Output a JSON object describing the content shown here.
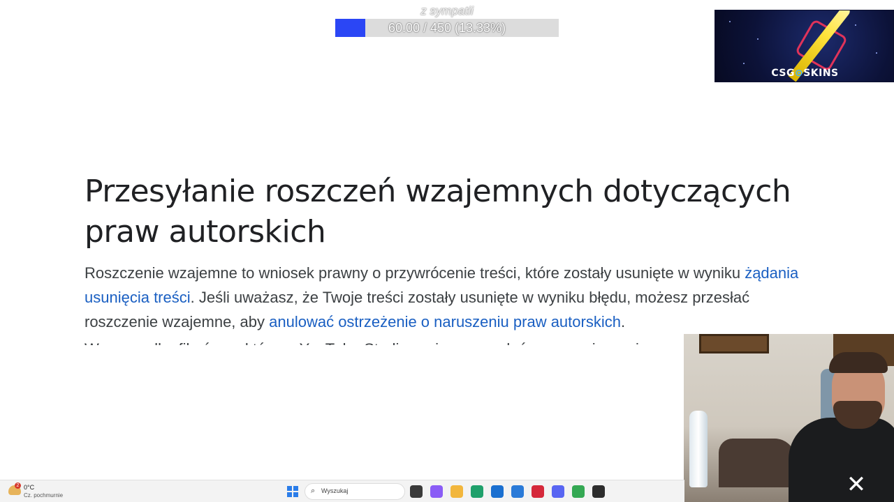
{
  "donation": {
    "label": "z sympatii",
    "progress_text": "60.00 / 450 (13.33%)",
    "progress_fraction": 0.1333,
    "fill_color": "#2b46f5"
  },
  "sponsor": {
    "logo_left": "CSG",
    "logo_mark": "⊙",
    "logo_right": "SKINS"
  },
  "article": {
    "title_line1": "Przesyłanie roszczeń wzajemnych dotyczących",
    "title_line2": "praw autorskich",
    "para": {
      "t1": "Roszczenie wzajemne to wniosek prawny o przywrócenie treści, które zostały usunięte w wyniku ",
      "link1": "żądania usunięcia treści",
      "t2": ". Jeśli uważasz, że Twoje treści zostały usunięte w wyniku błędu, możesz przesłać roszczenie wzajemne, aby ",
      "link2": "anulować ostrzeżenie o naruszeniu praw autorskich",
      "t3": "."
    },
    "cut_line": "W przypadku filmów, w którym, YouTube Studio możesz przesłać roszczenie wzajemne"
  },
  "taskbar": {
    "weather_badge": "2",
    "weather_temp": "0°C",
    "weather_desc": "Cz. pochmurnie",
    "search_placeholder": "Wyszukaj",
    "apps": [
      {
        "name": "task-view-icon",
        "color": "#3a3a3a"
      },
      {
        "name": "copilot-icon",
        "color": "#8a5cf6"
      },
      {
        "name": "file-explorer-icon",
        "color": "#f2b63c"
      },
      {
        "name": "edge-icon",
        "color": "#1fa06b"
      },
      {
        "name": "outlook-icon",
        "color": "#1a6fd0"
      },
      {
        "name": "store-icon",
        "color": "#2a7ad8"
      },
      {
        "name": "app-red-icon",
        "color": "#d5283a"
      },
      {
        "name": "discord-icon",
        "color": "#5865f2"
      },
      {
        "name": "chrome-icon",
        "color": "#34a853"
      },
      {
        "name": "app-dark-icon",
        "color": "#2d2d2d"
      }
    ]
  }
}
